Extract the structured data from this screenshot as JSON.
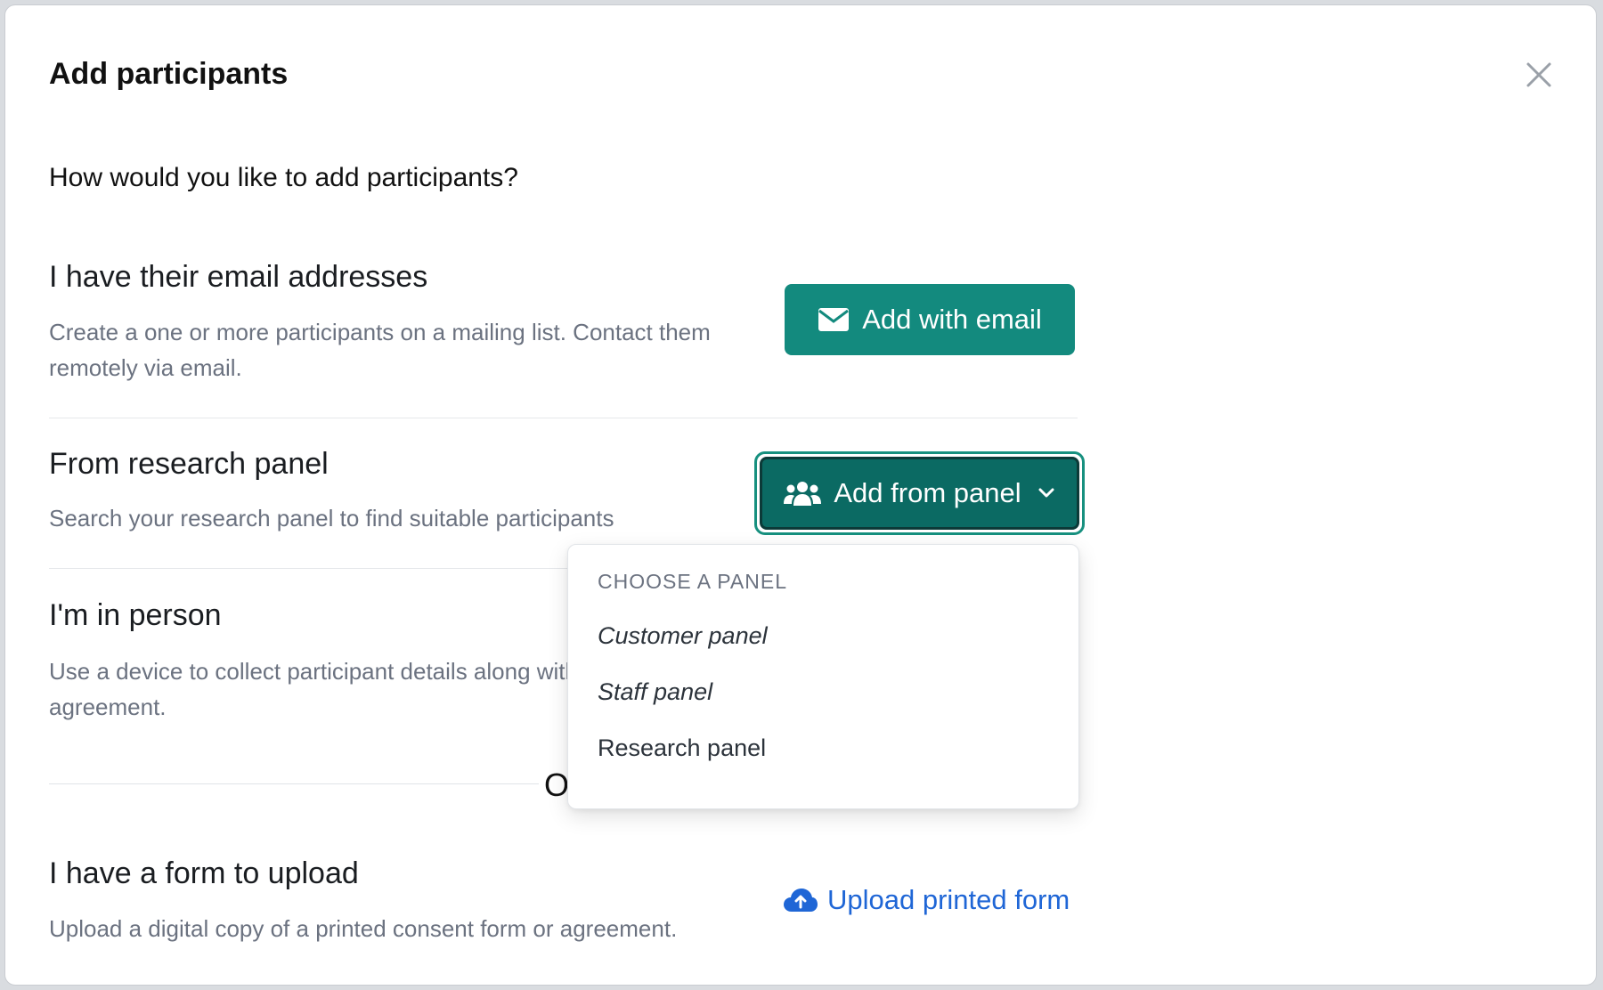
{
  "modal": {
    "title": "Add participants",
    "close_icon": "close-icon",
    "question": "How would you like to add participants?"
  },
  "sections": {
    "email": {
      "heading": "I have their email addresses",
      "description": "Create a one or more participants on a mailing list. Contact them remotely via email.",
      "button_label": "Add with email",
      "button_icon": "envelope-icon"
    },
    "panel": {
      "heading": "From research panel",
      "description": "Search your research panel to find suitable participants",
      "button_label": "Add from panel",
      "button_icon": "users-icon"
    },
    "in_person": {
      "heading": "I'm in person",
      "description": "Use a device to collect participant details along with consent or an agreement."
    },
    "or_text": "Or",
    "upload": {
      "heading": "I have a form to upload",
      "description": "Upload a digital copy of a printed consent form or agreement.",
      "link_label": "Upload printed form",
      "link_icon": "cloud-upload-icon"
    }
  },
  "dropdown": {
    "header": "CHOOSE A PANEL",
    "items": [
      {
        "label": "Customer panel"
      },
      {
        "label": "Staff panel"
      },
      {
        "label": "Research panel"
      }
    ]
  },
  "colors": {
    "primary": "#138a7e",
    "primary_dark": "#0b6a63",
    "link": "#1f66d6",
    "muted_text": "#6b7280"
  }
}
